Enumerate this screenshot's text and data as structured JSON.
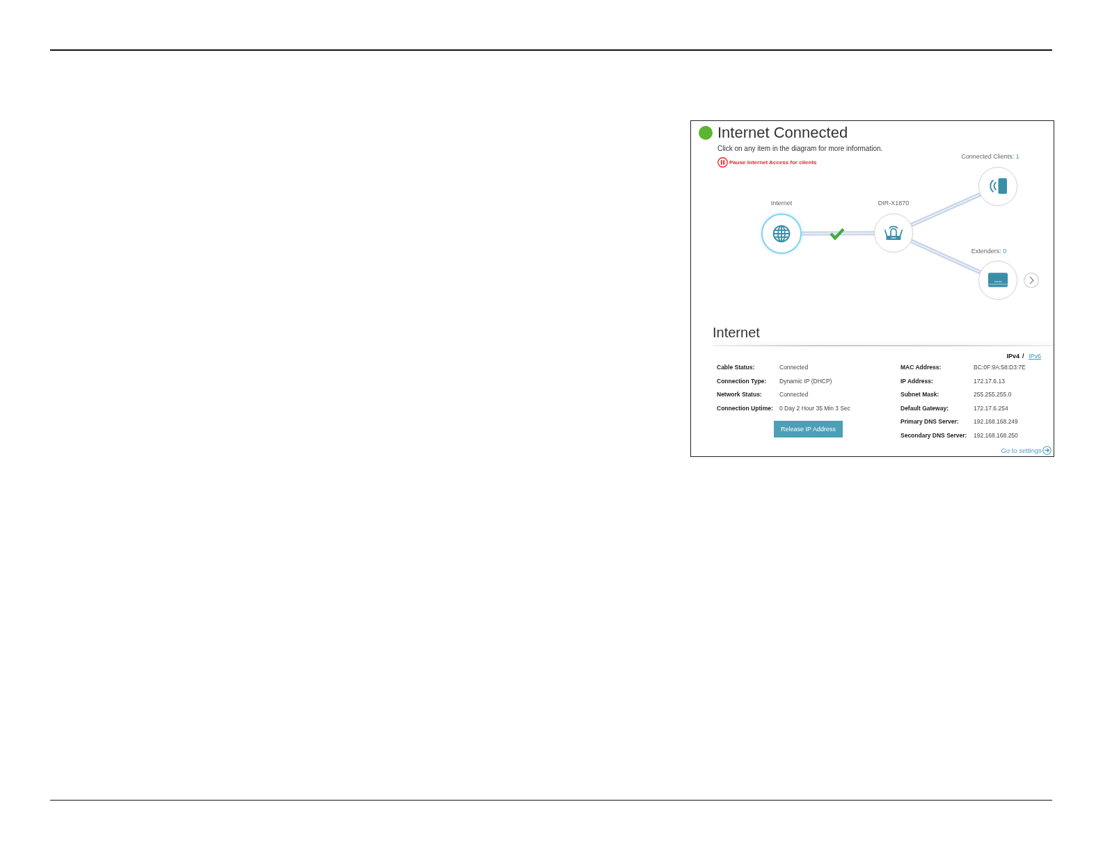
{
  "status": {
    "title": "Internet Connected",
    "connected": true
  },
  "hint": "Click on any item in the diagram for more information.",
  "pause_link": "Pause Internet Access for clients",
  "diagram": {
    "link_ok": true,
    "nodes": [
      {
        "kind": "internet",
        "label": "Internet",
        "selected": true
      },
      {
        "kind": "router",
        "label": "DIR-X1870",
        "selected": false
      },
      {
        "kind": "clients",
        "label": "Connected Clients:",
        "count": "1",
        "selected": false
      },
      {
        "kind": "extenders",
        "label": "Extenders:",
        "count": "0",
        "selected": false
      }
    ]
  },
  "section": {
    "title": "Internet",
    "ip_versions": [
      {
        "label": "IPv4",
        "selected": true
      },
      {
        "label": "IPv6",
        "selected": false
      }
    ],
    "ip_separator": "/",
    "left_fields": [
      {
        "label": "Cable Status:",
        "value": "Connected"
      },
      {
        "label": "Connection Type:",
        "value": "Dynamic IP (DHCP)"
      },
      {
        "label": "Network Status:",
        "value": "Connected"
      },
      {
        "label": "Connection Uptime:",
        "value": "0 Day 2 Hour 35 Min 3 Sec"
      }
    ],
    "button": "Release IP Address",
    "right_fields": [
      {
        "label": "MAC Address:",
        "value": "BC:0F:9A:58:D3:7E"
      },
      {
        "label": "IP Address:",
        "value": "172.17.6.13"
      },
      {
        "label": "Subnet Mask:",
        "value": "255.255.255.0"
      },
      {
        "label": "Default Gateway:",
        "value": "172.17.6.254"
      },
      {
        "label": "Primary DNS Server:",
        "value": "192.168.168.249"
      },
      {
        "label": "Secondary DNS Server:",
        "value": "192.168.168.250"
      }
    ],
    "settings_link": "Go to settings"
  }
}
